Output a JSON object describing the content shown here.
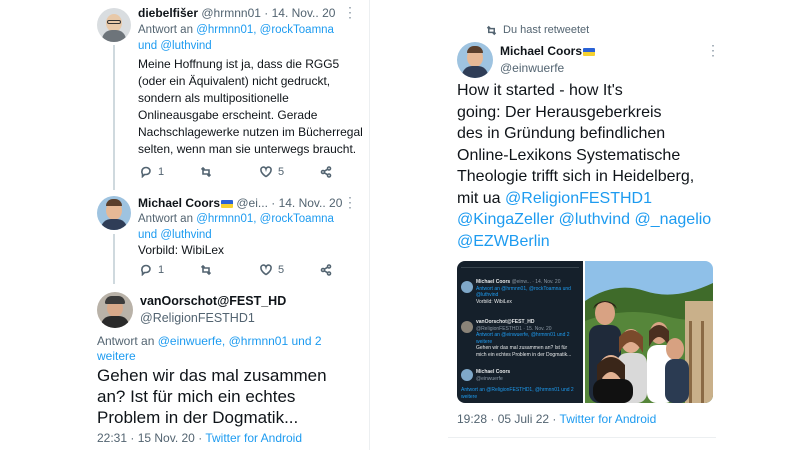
{
  "left": {
    "tweet1": {
      "name": "diebelfišer",
      "handle": "@hrmnn01",
      "date": "· 14. Nov.. 20",
      "reply_prefix": "Antwort an",
      "reply_to": "@hrmnn01, @rockToamna",
      "reply_to2": "und @luthvind",
      "body": "Meine Hoffnung ist ja, dass die RGG5 (oder ein Äquivalent) nicht gedruckt, sondern als multipositionelle Onlineausgabe erscheint. Gerade Nachschlagewerke nutzen im Bücherregal selten, wenn man sie unterwegs braucht.",
      "reply_count": "1",
      "retweet_count": "",
      "like_count": "5"
    },
    "tweet2": {
      "name": "Michael Coors",
      "handle": "@ei...",
      "date": "· 14. Nov.. 20",
      "reply_prefix": "Antwort an",
      "reply_to": "@hrmnn01, @rockToamna",
      "reply_to2": "und @luthvind",
      "body": "Vorbild: WibiLex",
      "reply_count": "1",
      "retweet_count": "",
      "like_count": "5"
    },
    "tweet3": {
      "name": "vanOorschot@FEST_HD",
      "handle": "@ReligionFESTHD1",
      "reply_prefix": "Antwort an",
      "reply_to": "@einwuerfe, @hrmnn01 und 2",
      "reply_to2": "weitere",
      "body": "Gehen wir das mal zusammen an? Ist für mich ein echtes Problem in der Dogmatik...",
      "timestamp": "22:31 · 15 Nov. 20",
      "source": "Twitter for Android"
    }
  },
  "right": {
    "retweet_label": "Du hast retweetet",
    "name": "Michael Coors",
    "handle": "@einwuerfe",
    "body_lines": [
      "How it started - how It's",
      "going: Der Herausgeberkreis",
      "des in Gründung befindlichen",
      "Online-Lexikons Systematische",
      "Theologie trifft sich in Heidelberg,"
    ],
    "body_mit": "mit ua",
    "mentions_line1": "@ReligionFESTHD1",
    "mentions_line2": "@KingaZeller @luthvind @_nagelio",
    "mentions_line3": "@EZWBerlin",
    "timestamp": "19:28 · 05 Juli 22",
    "dot": "·",
    "source": "Twitter for Android",
    "mini": {
      "n1": "Michael Coors",
      "h1": "@einw... · 14. Nov. 20",
      "r1": "Antwort an @hrmnn01, @rockToamna und @luthvind",
      "b1": "Vorbild: WibiLex",
      "n2": "vanOorschot@FEST_HD",
      "h2": "@ReligionFESTHD1 · 15. Nov. 20",
      "r2": "Antwort an @einwuerfe, @hrmnn01 und 2 weitere",
      "b2": "Gehen wir das mal zusammen an? Ist für mich ein echtes Problem in der Dogmatik...",
      "n3": "Michael Coors",
      "h3": "@einwuerfe",
      "r3": "Antwort an @ReligionFESTHD1, @hrmnn01 und 2 weitere"
    }
  }
}
